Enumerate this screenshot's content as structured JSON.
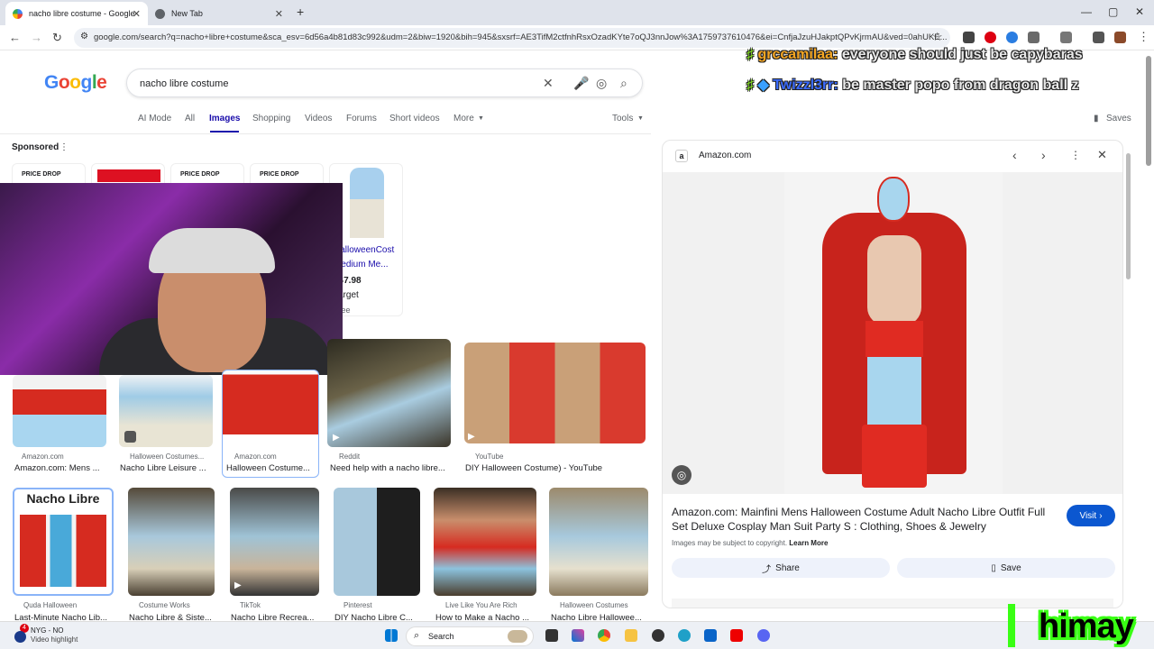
{
  "browser": {
    "tabs": [
      {
        "title": "nacho libre costume - Google"
      },
      {
        "title": "New Tab"
      }
    ],
    "url": "google.com/search?q=nacho+libre+costume&sca_esv=6d56a4b81d83c992&udm=2&biw=1920&bih=945&sxsrf=AE3TifM2ctfnhRsxOzadKYte7oQJ3nnJow%3A1759737610476&ei=CnfjaJzuHJakptQPvKjrmAU&ved=0ahUKE..."
  },
  "google": {
    "logo": "Google",
    "query": "nacho libre costume",
    "tabs": [
      "AI Mode",
      "All",
      "Images",
      "Shopping",
      "Videos",
      "Forums",
      "Short videos",
      "More"
    ],
    "tools": "Tools",
    "saves": "Saves",
    "sponsored": "Sponsored"
  },
  "chat": [
    {
      "user": "grccamilaa:",
      "message": "everyone should just be capybaras"
    },
    {
      "user": "Twizzl3rr:",
      "message": "be master popo from dragon ball z"
    }
  ],
  "ads": {
    "price_drop": "PRICE DROP",
    "product_title_1": "HalloweenCost",
    "product_title_2": "Medium Me...",
    "price": "$47.98",
    "store": "Target",
    "shipping": "Free"
  },
  "results_row1": [
    {
      "source": "Amazon.com",
      "title": "Amazon.com: Mens ..."
    },
    {
      "source": "Halloween Costumes...",
      "title": "Nacho Libre Leisure ..."
    },
    {
      "source": "Amazon.com",
      "title": "Halloween Costume..."
    },
    {
      "source": "Reddit",
      "title": "Need help with a nacho libre..."
    },
    {
      "source": "YouTube",
      "title": "DIY Halloween Costume) - YouTube"
    }
  ],
  "results_row2": [
    {
      "source": "Quda Halloween",
      "title": "Last-Minute Nacho Lib...",
      "banner": "Nacho Libre"
    },
    {
      "source": "Costume Works",
      "title": "Nacho Libre & Siste..."
    },
    {
      "source": "TikTok",
      "title": "Nacho Libre Recrea..."
    },
    {
      "source": "Pinterest",
      "title": "DIY Nacho Libre C..."
    },
    {
      "source": "Live Like You Are Rich",
      "title": "How to Make a Nacho ..."
    },
    {
      "source": "Halloween Costumes",
      "title": "Nacho Libre Hallowee..."
    }
  ],
  "panel": {
    "source": "Amazon.com",
    "title": "Amazon.com: Mainfini Mens Halloween Costume Adult Nacho Libre Outfit Full Set Deluxe Cosplay Man Suit Party S : Clothing, Shoes & Jewelry",
    "visit": "Visit",
    "copyright": "Images may be subject to copyright.",
    "learn_more": "Learn More",
    "share": "Share",
    "save": "Save"
  },
  "taskbar": {
    "notice_title": "NYG - NO",
    "notice_sub": "Video highlight",
    "search": "Search",
    "badge": "4"
  },
  "overlay": {
    "name": "himay"
  }
}
